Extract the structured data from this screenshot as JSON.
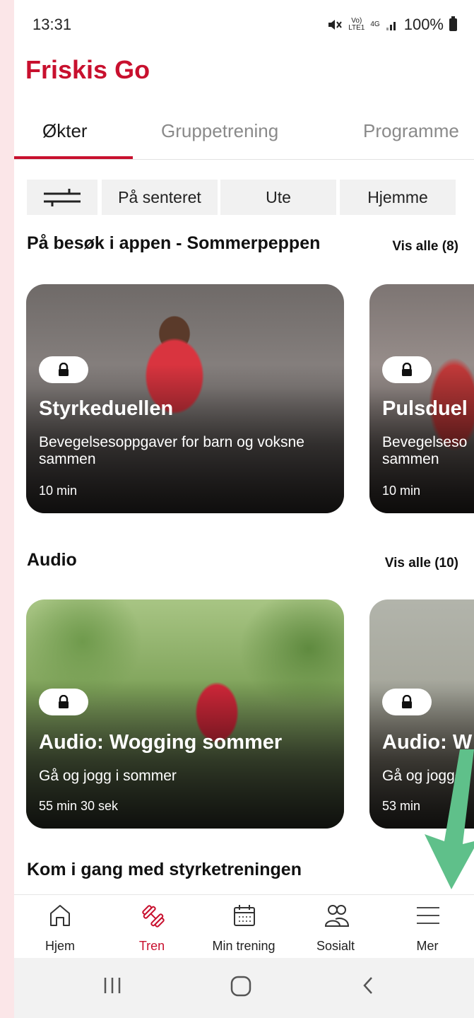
{
  "status": {
    "time": "13:31",
    "net_top": "Vo)",
    "net_bottom": "LTE1",
    "gen": "4G",
    "battery": "100%"
  },
  "app": {
    "title": "Friskis Go"
  },
  "tabs": [
    {
      "label": "Økter",
      "active": true
    },
    {
      "label": "Gruppetrening",
      "active": false
    },
    {
      "label": "Programme",
      "active": false
    }
  ],
  "filters": {
    "chips": [
      "På senteret",
      "Ute",
      "Hjemme"
    ]
  },
  "sections": [
    {
      "title": "På besøk i appen - Sommerpeppen",
      "see_all": "Vis alle (8)",
      "cards": [
        {
          "title": "Styrkeduellen",
          "subtitle": "Bevegelsesoppgaver for barn og voksne sammen",
          "duration": "10 min",
          "locked": true
        },
        {
          "title": "Pulsduel",
          "subtitle": "Bevegelseso sammen",
          "duration": "10 min",
          "locked": true
        }
      ]
    },
    {
      "title": "Audio",
      "see_all": "Vis alle (10)",
      "cards": [
        {
          "title": "Audio: Wogging sommer",
          "subtitle": "Gå og jogg i sommer",
          "duration": "55 min 30 sek",
          "locked": true
        },
        {
          "title": "Audio: W",
          "subtitle": "Gå og jogge",
          "duration": "53 min",
          "locked": true
        }
      ]
    },
    {
      "title": "Kom i gang med styrketreningen"
    }
  ],
  "bottom_nav": [
    {
      "label": "Hjem",
      "icon": "home-icon",
      "active": false
    },
    {
      "label": "Tren",
      "icon": "dumbbell-icon",
      "active": true
    },
    {
      "label": "Min trening",
      "icon": "calendar-icon",
      "active": false
    },
    {
      "label": "Sosialt",
      "icon": "people-icon",
      "active": false
    },
    {
      "label": "Mer",
      "icon": "menu-icon",
      "active": false
    }
  ],
  "colors": {
    "brand": "#c8102e",
    "arrow": "#5fc08a",
    "background": "#fbe6e8"
  }
}
